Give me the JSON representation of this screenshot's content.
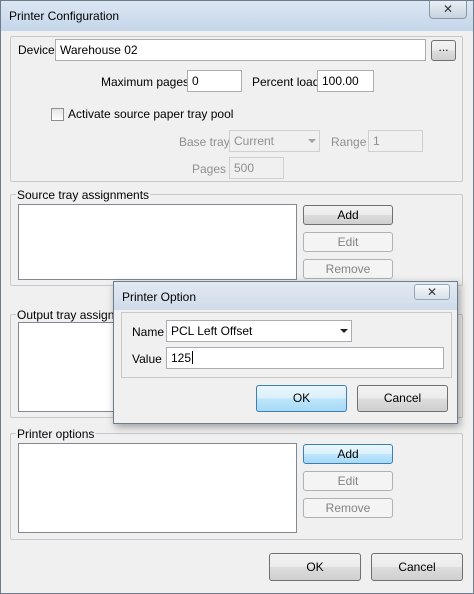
{
  "window": {
    "title": "Printer Configuration",
    "close_glyph": "✕"
  },
  "device": {
    "label": "Device",
    "value": "Warehouse 02",
    "browse_label": "..."
  },
  "max_pages": {
    "label": "Maximum pages",
    "value": "0"
  },
  "percent_load": {
    "label": "Percent load",
    "value": "100.00"
  },
  "tray_pool": {
    "label": "Activate source paper tray pool",
    "checked": false
  },
  "base_tray": {
    "label": "Base tray",
    "value": "Current"
  },
  "range": {
    "label": "Range",
    "value": "1"
  },
  "pages": {
    "label": "Pages",
    "value": "500"
  },
  "source_trays": {
    "label": "Source tray assignments",
    "add": "Add",
    "edit": "Edit",
    "remove": "Remove"
  },
  "output_trays": {
    "label": "Output tray assignments"
  },
  "printer_options": {
    "label": "Printer options",
    "add": "Add",
    "edit": "Edit",
    "remove": "Remove"
  },
  "footer": {
    "ok": "OK",
    "cancel": "Cancel"
  },
  "dialog": {
    "title": "Printer Option",
    "close_glyph": "✕",
    "name_label": "Name",
    "name_value": "PCL Left Offset",
    "value_label": "Value",
    "value_value": "125",
    "ok": "OK",
    "cancel": "Cancel"
  }
}
